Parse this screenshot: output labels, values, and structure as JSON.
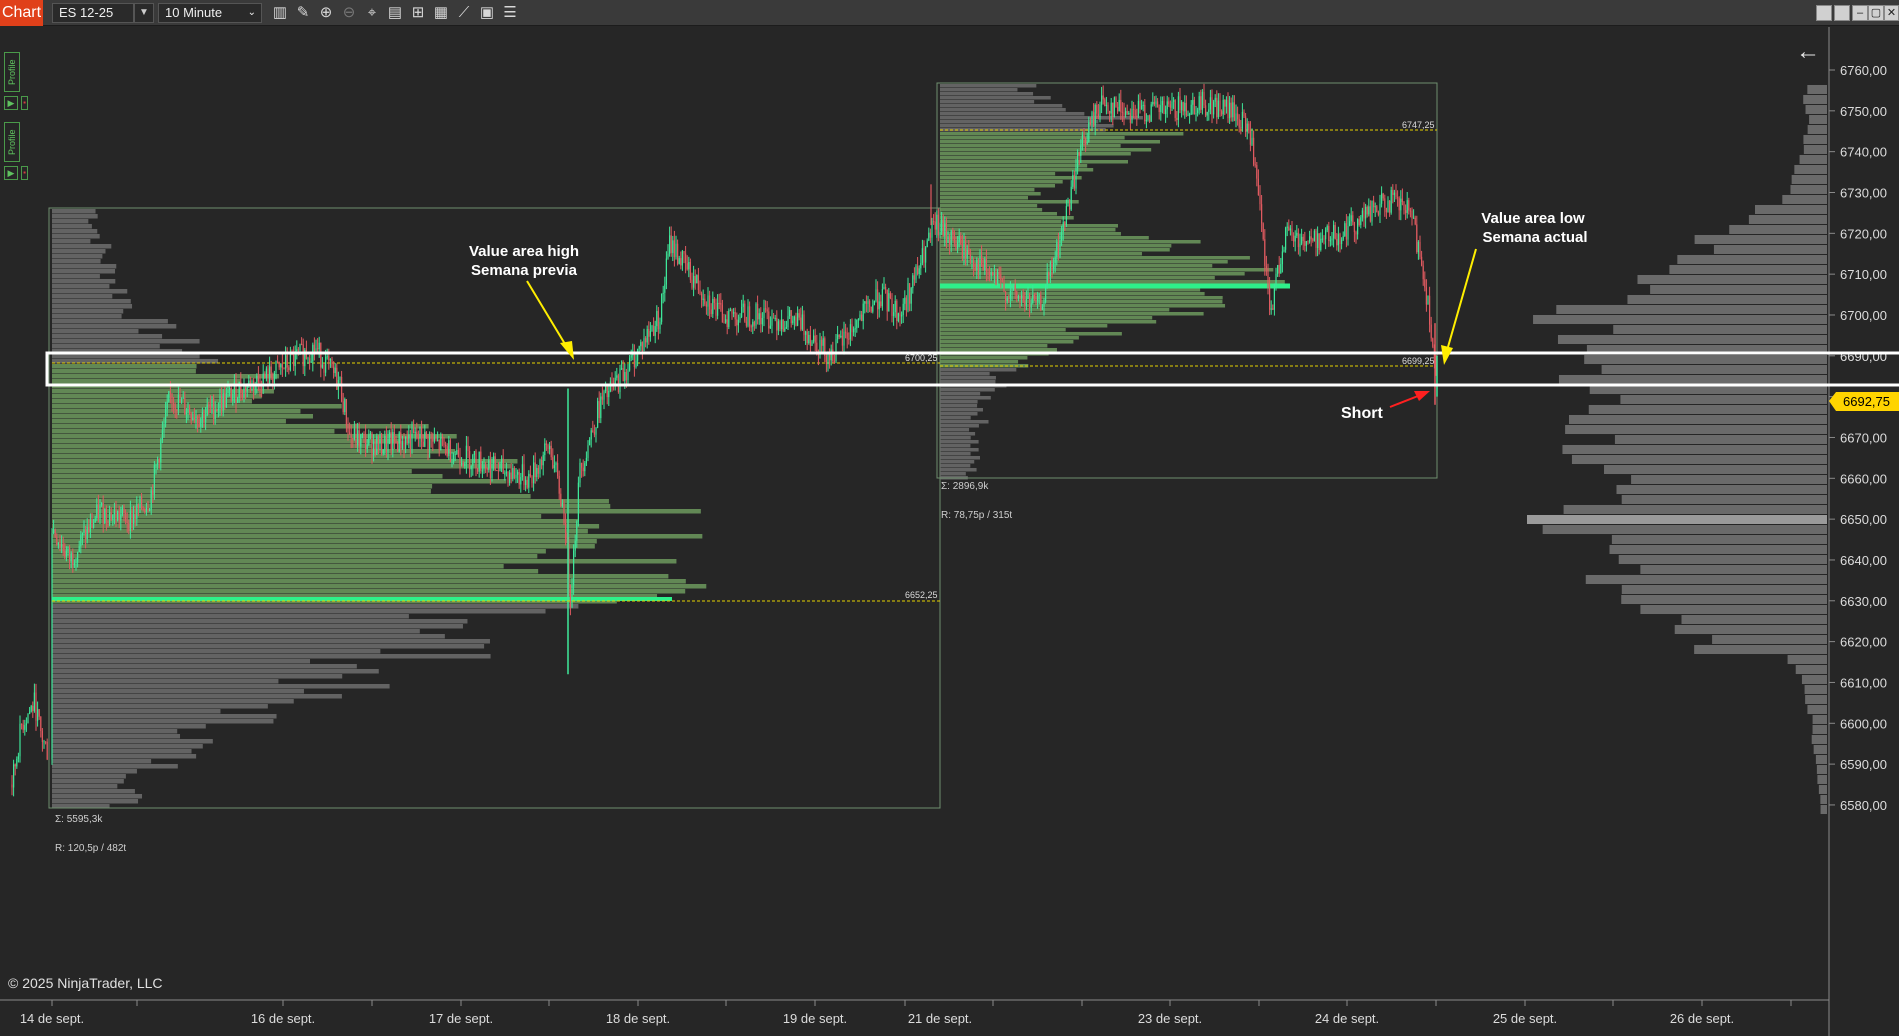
{
  "toolbar": {
    "tab_label": "Chart",
    "instrument": "ES 12-25",
    "interval": "10 Minute",
    "icons": [
      "bar-type-icon",
      "draw-pencil-icon",
      "zoom-in-icon",
      "zoom-out-icon",
      "crosshair-icon",
      "data-box-icon",
      "properties-icon",
      "indicators-icon",
      "strategies-icon",
      "templates-icon",
      "list-icon"
    ]
  },
  "side_panel": {
    "profile_label_1": "Profile",
    "profile_label_2": "Profile",
    "play": "▶",
    "dot": "▪"
  },
  "price_axis": {
    "ticks": [
      "6760,00",
      "6750,00",
      "6740,00",
      "6730,00",
      "6720,00",
      "6710,00",
      "6700,00",
      "6690,00",
      "6680,00",
      "6670,00",
      "6660,00",
      "6650,00",
      "6640,00",
      "6630,00",
      "6620,00",
      "6610,00",
      "6600,00",
      "6590,00",
      "6580,00"
    ],
    "current_price": "6692,75",
    "current_price_color": "#ffd400"
  },
  "time_axis": {
    "labels": [
      "14 de sept.",
      "16 de sept.",
      "17 de sept.",
      "18 de sept.",
      "19 de sept.",
      "21 de sept.",
      "23 de sept.",
      "24 de sept.",
      "25 de sept.",
      "26 de sept."
    ]
  },
  "profiles": {
    "prev_week": {
      "vah": "6700,25",
      "val": "6652,25",
      "sum": "Σ: 5595,3k",
      "range": "R: 120,5p / 482t"
    },
    "curr_week": {
      "vah": "6747,25",
      "val": "6699,25",
      "sum": "Σ: 2896,9k",
      "range": "R: 78,75p / 315t"
    }
  },
  "annotations": {
    "vah_prev_line1": "Value area high",
    "vah_prev_line2": "Semana previa",
    "val_curr_line1": "Value area low",
    "val_curr_line2": "Semana actual",
    "short": "Short"
  },
  "colors": {
    "up_candle": "#3ee89a",
    "down_candle": "#e05a60",
    "poc": "#2ef08a",
    "value_area": "#6d9a5e",
    "profile_grey": "#6a6a6a",
    "annotation_yellow": "#ffee00",
    "annotation_red": "#ff2020"
  },
  "copyright": "© 2025 NinjaTrader, LLC"
}
